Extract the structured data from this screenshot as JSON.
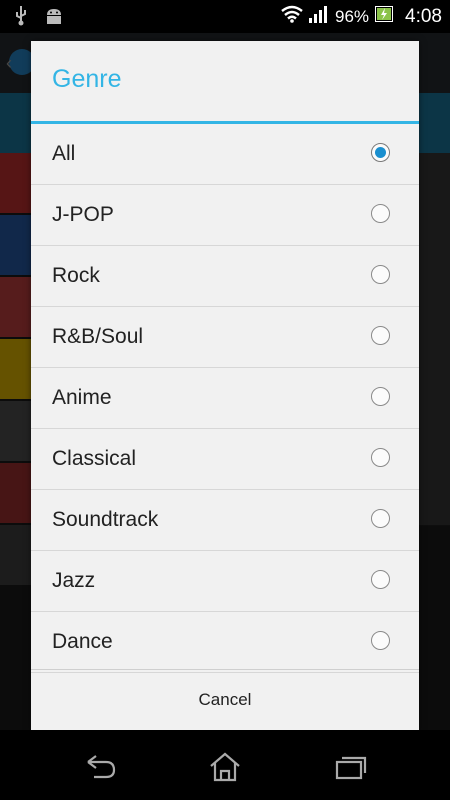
{
  "status_bar": {
    "battery_percent": "96%",
    "time": "4:08",
    "left_icons": [
      "usb-icon",
      "android-debug-icon"
    ],
    "right_icons": [
      "wifi-icon",
      "signal-icon",
      "battery-charging-icon"
    ]
  },
  "dialog": {
    "title": "Genre",
    "accent_color": "#33b5e5",
    "selected_index": 0,
    "options": [
      {
        "label": "All",
        "checked": true
      },
      {
        "label": "J-POP",
        "checked": false
      },
      {
        "label": "Rock",
        "checked": false
      },
      {
        "label": "R&B/Soul",
        "checked": false
      },
      {
        "label": "Anime",
        "checked": false
      },
      {
        "label": "Classical",
        "checked": false
      },
      {
        "label": "Soundtrack",
        "checked": false
      },
      {
        "label": "Jazz",
        "checked": false
      },
      {
        "label": "Dance",
        "checked": false
      }
    ],
    "cancel_label": "Cancel"
  },
  "nav_bar": {
    "buttons": [
      "back-icon",
      "home-icon",
      "recent-apps-icon"
    ]
  }
}
